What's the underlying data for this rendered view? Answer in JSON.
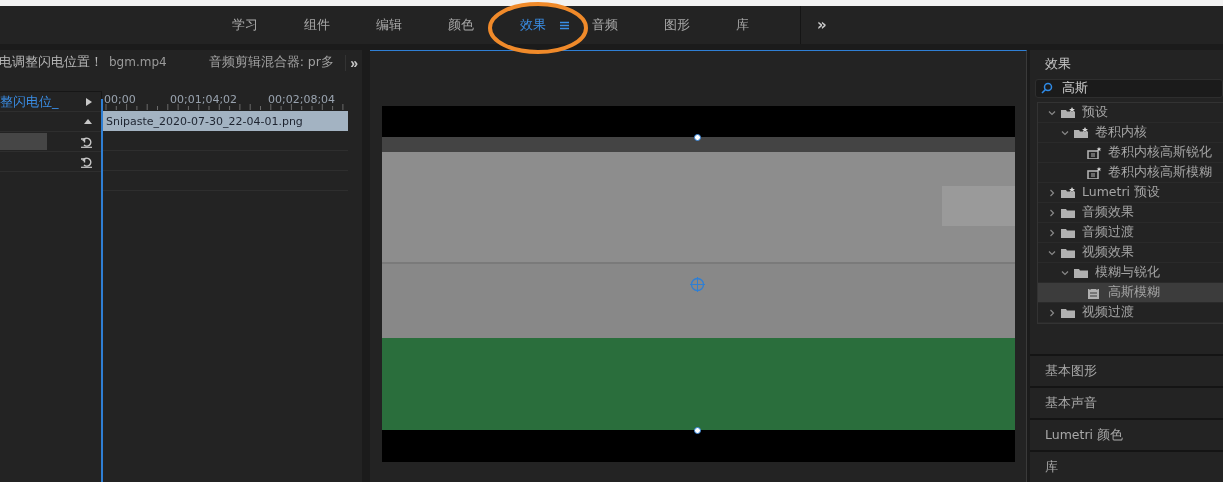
{
  "menu_bar": {
    "workspaces": [
      {
        "label": "学习",
        "selected": false
      },
      {
        "label": "组件",
        "selected": false
      },
      {
        "label": "编辑",
        "selected": false
      },
      {
        "label": "颜色",
        "selected": false
      },
      {
        "label": "效果",
        "selected": true
      },
      {
        "label": "音频",
        "selected": false
      },
      {
        "label": "图形",
        "selected": false
      },
      {
        "label": "库",
        "selected": false
      }
    ],
    "overflow": "»"
  },
  "source_panel": {
    "tabs": [
      {
        "label": "电调整闪电位置！"
      },
      {
        "label": "bgm.mp4"
      },
      {
        "label": "音频剪辑混合器: pr多"
      }
    ],
    "overflow": "»"
  },
  "effect_controls": {
    "clip_label": "整闪电位_",
    "times": [
      "00;00",
      "00;01;04;02",
      "00;02;08;04"
    ],
    "clip": "Snipaste_2020-07-30_22-04-01.png"
  },
  "effects_panel": {
    "title": "效果",
    "search": {
      "value": "高斯"
    },
    "tree": [
      {
        "label": "预设",
        "kind": "preset-folder",
        "expanded": true,
        "selected": false,
        "children": [
          {
            "label": "卷积内核",
            "kind": "preset-folder",
            "expanded": true,
            "selected": false,
            "children": [
              {
                "label": "卷积内核高斯锐化",
                "kind": "preset",
                "selected": false
              },
              {
                "label": "卷积内核高斯模糊",
                "kind": "preset",
                "selected": false
              }
            ]
          }
        ]
      },
      {
        "label": "Lumetri 预设",
        "kind": "preset-folder",
        "expanded": false,
        "selected": false
      },
      {
        "label": "音频效果",
        "kind": "folder",
        "expanded": false,
        "selected": false
      },
      {
        "label": "音频过渡",
        "kind": "folder",
        "expanded": false,
        "selected": false
      },
      {
        "label": "视频效果",
        "kind": "folder",
        "expanded": true,
        "selected": false,
        "children": [
          {
            "label": "模糊与锐化",
            "kind": "folder",
            "expanded": true,
            "selected": false,
            "children": [
              {
                "label": "高斯模糊",
                "kind": "effect",
                "selected": true
              }
            ]
          }
        ]
      },
      {
        "label": "视频过渡",
        "kind": "folder",
        "expanded": false,
        "selected": false
      }
    ]
  },
  "panels": [
    {
      "title": "基本图形"
    },
    {
      "title": "基本声音"
    },
    {
      "title": "Lumetri 颜色"
    },
    {
      "title": "库"
    }
  ]
}
